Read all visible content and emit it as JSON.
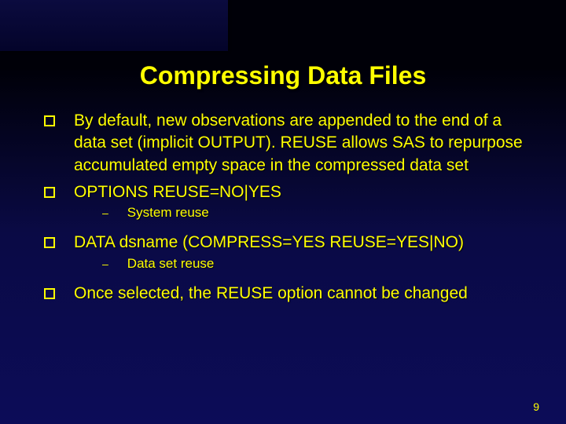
{
  "title": "Compressing Data Files",
  "bullets": {
    "b1": "By default, new observations are appended to the end of a data set (implicit OUTPUT).  REUSE allows SAS to repurpose accumulated empty space in the compressed data set",
    "b2": "OPTIONS REUSE=NO|YES",
    "b2_sub": "System reuse",
    "b3": "DATA dsname (COMPRESS=YES REUSE=YES|NO)",
    "b3_sub": "Data set reuse",
    "b4": "Once selected, the REUSE option cannot be changed"
  },
  "page_number": "9"
}
